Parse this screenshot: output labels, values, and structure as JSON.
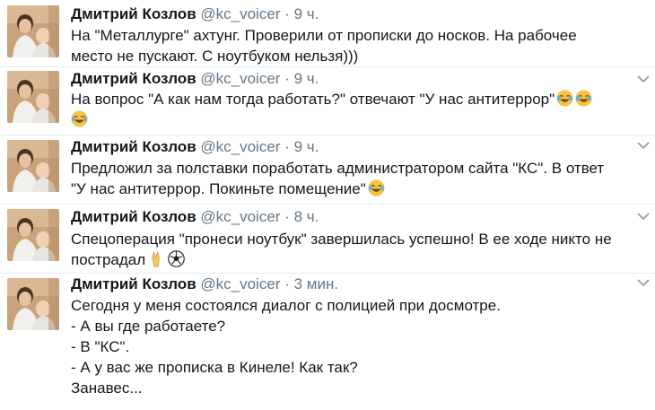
{
  "tweets": [
    {
      "name": "Дмитрий Козлов",
      "handle": "@kc_voicer",
      "dot": "·",
      "time": "9 ч.",
      "lines": [
        "На \"Металлурге\" ахтунг. Проверили от прописки до носков. На рабочее",
        "место не пускают. С ноутбуком нельзя)))"
      ]
    },
    {
      "name": "Дмитрий Козлов",
      "handle": "@kc_voicer",
      "dot": "·",
      "time": "9 ч.",
      "lines": [
        "На вопрос \"А как нам тогда работать?\" отвечают \"У нас антитеррор\""
      ],
      "emoji": [
        "face-with-tears-of-joy-icon",
        "face-with-tears-of-joy-icon",
        "face-with-tears-of-joy-icon"
      ]
    },
    {
      "name": "Дмитрий Козлов",
      "handle": "@kc_voicer",
      "dot": "·",
      "time": "9 ч.",
      "lines": [
        "Предложил за полставки поработать администратором сайта \"КС\". В ответ",
        "\"У нас антитеррор. Покиньте помещение\""
      ],
      "emoji": [
        "face-with-tears-of-joy-icon"
      ]
    },
    {
      "name": "Дмитрий Козлов",
      "handle": "@kc_voicer",
      "dot": "·",
      "time": "8 ч.",
      "lines": [
        "Спецоперация \"пронеси ноутбук\" завершилась успешно! В ее ходе никто не",
        "пострадал"
      ],
      "emoji": [
        "victory-hand-icon",
        "soccer-ball-icon"
      ]
    },
    {
      "name": "Дмитрий Козлов",
      "handle": "@kc_voicer",
      "dot": "·",
      "time": "3 мин.",
      "lines": [
        "Сегодня у меня состоялся диалог с полицией при досмотре.",
        "- А вы где работаете?",
        "- В \"КС\".",
        "- А у вас же прописка в Кинеле! Как так?",
        "Занавес..."
      ]
    }
  ],
  "colors": {
    "name": "#14171a",
    "meta": "#657786",
    "divider": "#e6ecf0",
    "emoji": "#f7c23e"
  }
}
